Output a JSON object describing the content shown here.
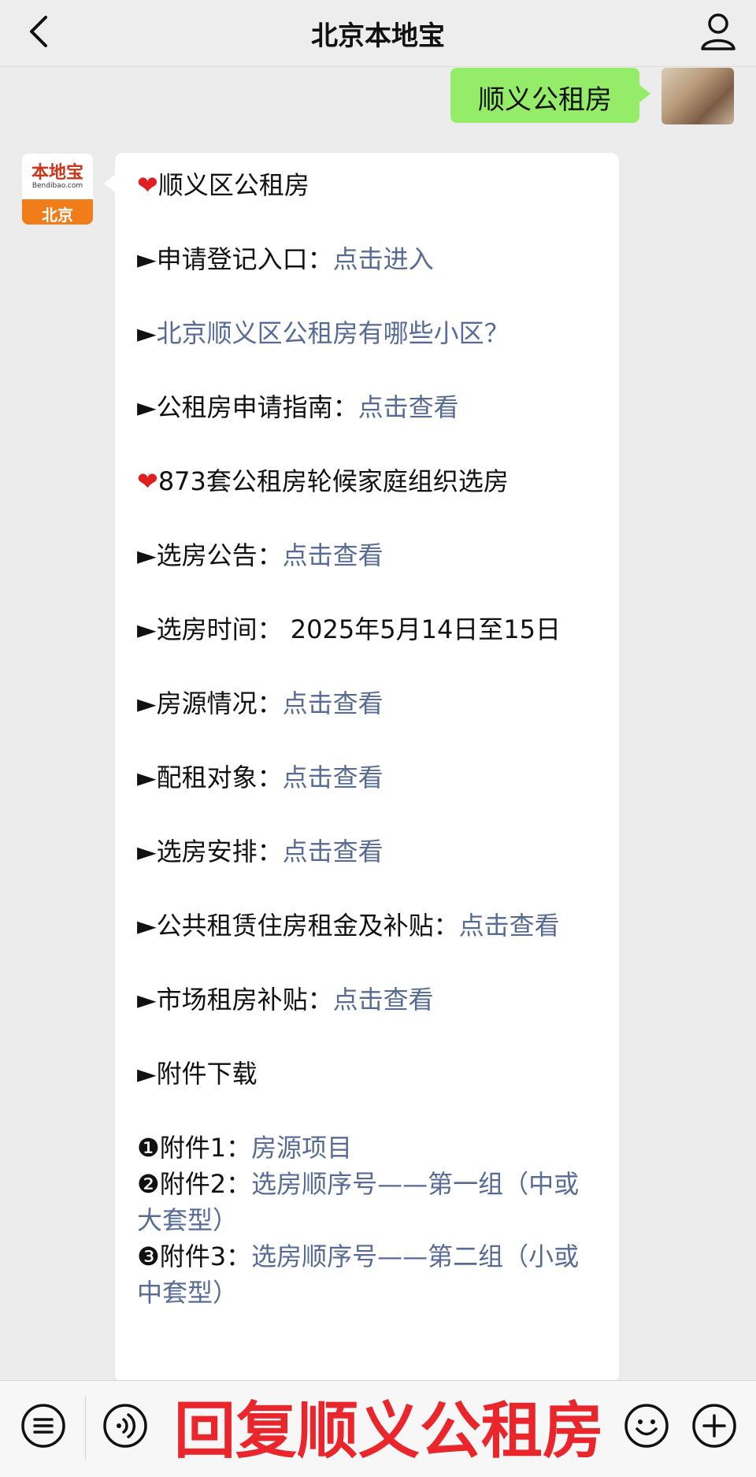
{
  "header": {
    "title": "北京本地宝"
  },
  "outgoing": {
    "text": "顺义公租房"
  },
  "avatar": {
    "brand": "本地宝",
    "domain": "Bendibao.com",
    "city": "北京"
  },
  "message": {
    "heading1": "顺义区公租房",
    "apply_label": "►申请登记入口：",
    "apply_link": "点击进入",
    "communities_prefix": "►",
    "communities_link": "北京顺义区公租房有哪些小区？",
    "guide_label": "►公租房申请指南：",
    "guide_link": "点击查看",
    "heading2": "873套公租房轮候家庭组织选房",
    "notice_label": "►选房公告：",
    "notice_link": "点击查看",
    "time_text": "►选房时间： 2025年5月14日至15日",
    "source_label": "►房源情况：",
    "source_link": "点击查看",
    "target_label": "►配租对象：",
    "target_link": "点击查看",
    "arrange_label": "►选房安排：",
    "arrange_link": "点击查看",
    "rent_label": "►公共租赁住房租金及补贴：",
    "rent_link": "点击查看",
    "market_label": "►市场租房补贴：",
    "market_link": "点击查看",
    "attach_heading": "►附件下载",
    "attachments": [
      {
        "num": "❶",
        "label": "附件1：",
        "link": "房源项目"
      },
      {
        "num": "❷",
        "label": "附件2：",
        "link": "选房顺序号——第一组（中或大套型）"
      },
      {
        "num": "❸",
        "label": "附件3：",
        "link": "选房顺序号——第二组（小或中套型）"
      }
    ]
  },
  "bottom": {
    "reply_banner": "回复顺义公租房"
  },
  "icons": [
    "back-icon",
    "profile-icon",
    "heart-icon",
    "menu-icon",
    "voice-icon",
    "emoji-icon",
    "plus-icon"
  ],
  "colors": {
    "bubble_out": "#95ec69",
    "link": "#576b95",
    "banner": "#e8262c",
    "brand_orange": "#f07c1a"
  }
}
